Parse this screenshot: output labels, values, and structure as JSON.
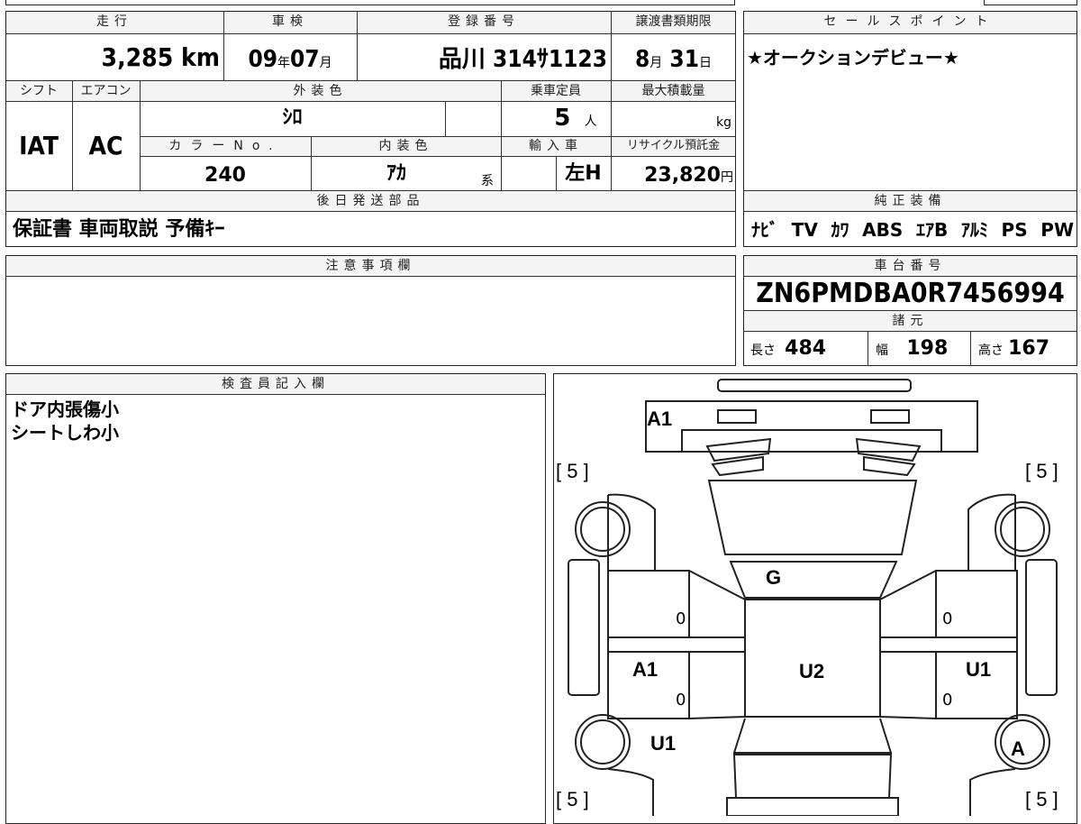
{
  "header": {
    "mileage_label": "走行",
    "inspection_label": "車検",
    "registration_label": "登録番号",
    "transfer_deadline_label": "譲渡書類期限",
    "sales_point_label": "セールスポイント"
  },
  "values": {
    "mileage": "3,285",
    "mileage_unit": "km",
    "inspection_year": "09",
    "inspection_year_unit": "年",
    "inspection_month": "07",
    "inspection_month_unit": "月",
    "registration": "品川 314ｻ1123",
    "deadline_month": "8",
    "deadline_month_unit": "月",
    "deadline_day": "31",
    "deadline_day_unit": "日"
  },
  "sales_point": "★オークションデビュー★",
  "row2_labels": {
    "shift": "シフト",
    "aircon": "エアコン",
    "exterior_color": "外装色",
    "capacity": "乗車定員",
    "max_load": "最大積載量",
    "color_no": "カラーNo.",
    "interior_color": "内装色",
    "import": "輸入車",
    "recycle": "リサイクル預託金"
  },
  "row2_values": {
    "shift": "IAT",
    "aircon": "AC",
    "exterior_color": "ｼﾛ",
    "capacity": "5",
    "capacity_unit": "人",
    "max_load_unit": "kg",
    "color_no": "240",
    "interior_color": "ｱｶ",
    "interior_suffix": "系",
    "import": "左H",
    "recycle": "23,820",
    "recycle_unit": "円"
  },
  "later_parts": {
    "label": "後日発送部品",
    "value": "保証書 車両取説 予備ｷｰ"
  },
  "genuine_equipment": {
    "label": "純正装備",
    "items": [
      "ﾅﾋﾞ",
      "TV",
      "ｶﾜ",
      "ABS",
      "ｴｱB",
      "ｱﾙﾐ",
      "PS",
      "PW"
    ]
  },
  "notes": {
    "label": "注意事項欄"
  },
  "chassis": {
    "label": "車台番号",
    "value": "ZN6PMDBA0R7456994"
  },
  "specs": {
    "label": "諸元",
    "length_label": "長さ",
    "length": "484",
    "width_label": "幅",
    "width": "198",
    "height_label": "高さ",
    "height": "167"
  },
  "inspector": {
    "label": "検査員記入欄",
    "lines": [
      "ドア内張傷小",
      "シートしわ小"
    ]
  },
  "diagram": {
    "marks": {
      "front": "A1",
      "hood_glass": "G",
      "roof": "U2",
      "left_door_rear": "A1",
      "right_door_rear": "U1",
      "left_rear_wheel": "U1",
      "right_rear_wheel": "A"
    },
    "tires": {
      "front_left": "[ 5 ]",
      "front_right": "[ 5 ]",
      "rear_left": "[ 5 ]",
      "rear_right": "[ 5 ]"
    },
    "zeros": [
      "0",
      "0",
      "0",
      "0"
    ]
  }
}
